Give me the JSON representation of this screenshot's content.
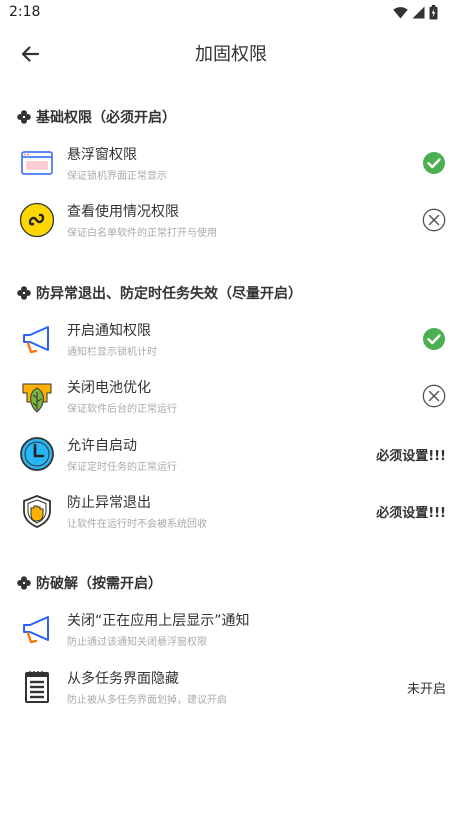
{
  "status_bar": {
    "time": "2:18"
  },
  "header": {
    "title": "加固权限"
  },
  "sections": [
    {
      "title": "基础权限（必须开启）",
      "items": [
        {
          "title": "悬浮窗权限",
          "subtitle": "保证锁机界面正常显示",
          "status": "granted"
        },
        {
          "title": "查看使用情况权限",
          "subtitle": "保证白名单软件的正常打开与使用",
          "status": "denied"
        }
      ]
    },
    {
      "title": "防异常退出、防定时任务失效（尽量开启）",
      "items": [
        {
          "title": "开启通知权限",
          "subtitle": "通知栏显示锁机计时",
          "status": "granted"
        },
        {
          "title": "关闭电池优化",
          "subtitle": "保证软件后台的正常运行",
          "status": "denied"
        },
        {
          "title": "允许自启动",
          "subtitle": "保证定时任务的正常运行",
          "status_text": "必须设置!!!"
        },
        {
          "title": "防止异常退出",
          "subtitle": "让软件在运行时不会被系统回收",
          "status_text": "必须设置!!!"
        }
      ]
    },
    {
      "title": "防破解（按需开启）",
      "items": [
        {
          "title": "关闭“正在应用上层显示”通知",
          "subtitle": "防止通过该通知关闭悬浮窗权限"
        },
        {
          "title": "从多任务界面隐藏",
          "subtitle": "防止被从多任务界面划掉，建议开启",
          "status_text": "未开启"
        }
      ]
    }
  ],
  "colors": {
    "granted": "#4CAF50",
    "denied": "#555555",
    "accent_blue": "#2962FF",
    "accent_orange": "#FF6D00"
  }
}
